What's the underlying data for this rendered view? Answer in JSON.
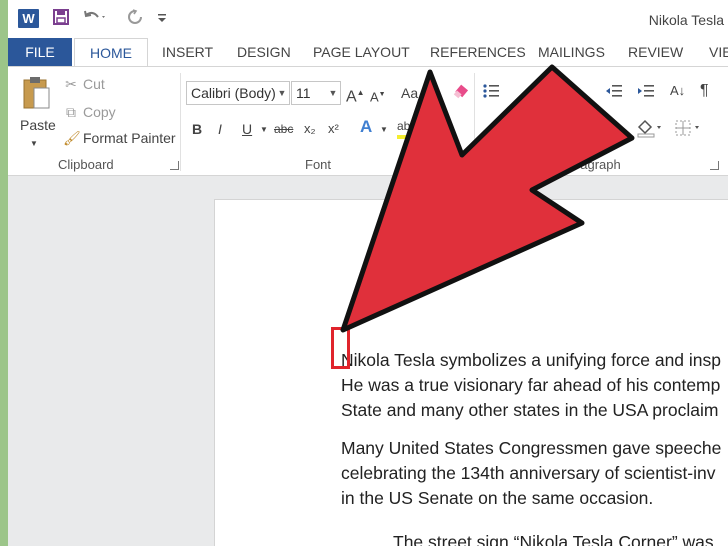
{
  "window": {
    "title": "Nikola Tesla"
  },
  "quick_access": {
    "icons": [
      "word-logo",
      "save-icon",
      "undo-icon",
      "redo-icon",
      "customize-icon"
    ],
    "logo_letter": "W"
  },
  "tabs": [
    {
      "label": "FILE"
    },
    {
      "label": "HOME"
    },
    {
      "label": "INSERT"
    },
    {
      "label": "DESIGN"
    },
    {
      "label": "PAGE LAYOUT"
    },
    {
      "label": "REFERENCES"
    },
    {
      "label": "MAILINGS"
    },
    {
      "label": "REVIEW"
    },
    {
      "label": "VIE"
    }
  ],
  "clipboard": {
    "paste": "Paste",
    "cut": "Cut",
    "copy": "Copy",
    "format_painter": "Format Painter",
    "label": "Clipboard"
  },
  "font": {
    "name": "Calibri (Body)",
    "size": "11",
    "label": "Font",
    "case_label": "Aa",
    "grow": "A",
    "shrink": "A",
    "bold": "B",
    "italic": "I",
    "underline": "U",
    "strike": "abc",
    "subscript": "x₂",
    "superscript": "x²",
    "effects": "A",
    "highlight": "ab"
  },
  "paragraph": {
    "label": "Paragraph",
    "pilcrow": "¶"
  },
  "document": {
    "paragraphs": [
      "Nikola Tesla symbolizes a unifying force and insp",
      "He was a true visionary far ahead of his contemp",
      "State and many other states in the USA proclaim",
      "Many United States Congressmen gave speeche",
      "celebrating the 134th anniversary of scientist-inv",
      "in the US Senate on the same occasion.",
      "The street sign “Nikola Tesla Corner” was"
    ]
  },
  "colors": {
    "accent": "#2b579a",
    "arrow_fill": "#e0303b",
    "frame": "#9cc589"
  }
}
